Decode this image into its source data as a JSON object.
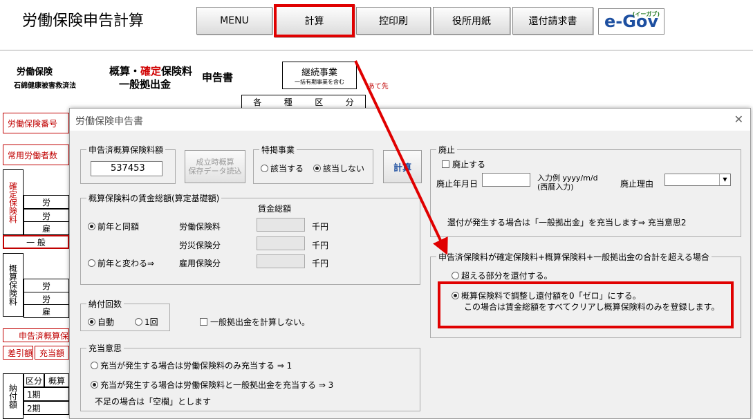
{
  "app": {
    "title": "労働保険申告計算"
  },
  "toolbar": {
    "menu": "MENU",
    "calc": "計算",
    "copy_print": "控印刷",
    "office_paper": "役所用紙",
    "refund": "還付請求書",
    "egov_logo": "e-Gov",
    "egov_sub": "(イーガブ)"
  },
  "sheet": {
    "l1": "労働保険",
    "l2": "石綿健康被害救済法",
    "c1a": "概算・",
    "c1b": "確定",
    "c1c": "保険料",
    "c2": "一般拠出金",
    "shinkokusho": "申告書",
    "keizoku": "継続事業",
    "keizoku_sub": "一括有期事業を含む",
    "atesaki": "あて先",
    "kubun": [
      "各",
      "種",
      "区",
      "分"
    ],
    "side_labels": [
      "労働保険番号",
      "常用労働者数",
      "申告済概算保",
      "差引額",
      "充当額"
    ],
    "kakutei_vert": "確定保険料",
    "gaisan_vert": "概算保険料",
    "nofu_vert": "納付額",
    "rou": "労",
    "ko": "雇",
    "ippan": "一 般",
    "kubun2": "区分",
    "gaisan2": "概算",
    "ki1": "1期",
    "ki2": "2期"
  },
  "dialog": {
    "title": "労働保険申告書",
    "close": "✕",
    "reported": {
      "legend": "申告済概算保険料額",
      "value": "537453"
    },
    "load_button": "成立時概算\n保存データ読込",
    "special": {
      "legend": "特掲事業",
      "yes": "該当する",
      "no": "該当しない",
      "selected": "no"
    },
    "calc_button": "計算",
    "wages": {
      "legend": "概算保険料の賃金総額(算定基礎額)",
      "header": "賃金総額",
      "same": "前年と同額",
      "diff": "前年と変わる⇒",
      "selected": "same",
      "rows": [
        {
          "label": "労働保険料",
          "unit": "千円"
        },
        {
          "label": "労災保険分",
          "unit": "千円"
        },
        {
          "label": "雇用保険分",
          "unit": "千円"
        }
      ]
    },
    "payments": {
      "legend": "納付回数",
      "auto": "自動",
      "once": "1回",
      "selected": "auto"
    },
    "no_general": "一般拠出金を計算しない。",
    "allocation": {
      "legend": "充当意思",
      "opt1": "充当が発生する場合は労働保険料のみ充当する ⇒ 1",
      "opt2": "充当が発生する場合は労働保険料と一般拠出金を充当する ⇒ 3",
      "note": "不足の場合は「空欄」とします",
      "selected": 2
    },
    "abolition": {
      "legend": "廃止",
      "check": "廃止する",
      "date_label": "廃止年月日",
      "example": "入力例 yyyy/m/d",
      "example2": "(西暦入力)",
      "reason": "廃止理由",
      "refund_note": "還付が発生する場合は「一般拠出金」を充当します⇒ 充当意思2"
    },
    "exceed": {
      "legend": "申告済保険料が確定保険料+概算保険料+一般拠出金の合計を超える場合",
      "opt1": "超える部分を還付する。",
      "opt2": "概算保険料で調整し還付額を0「ゼロ」にする。",
      "note": "この場合は賃金総額をすべてクリアし概算保険料のみを登録します。",
      "selected": 2
    }
  },
  "colors": {
    "annotation": "#e00000",
    "egov": "#1d4fa0"
  }
}
